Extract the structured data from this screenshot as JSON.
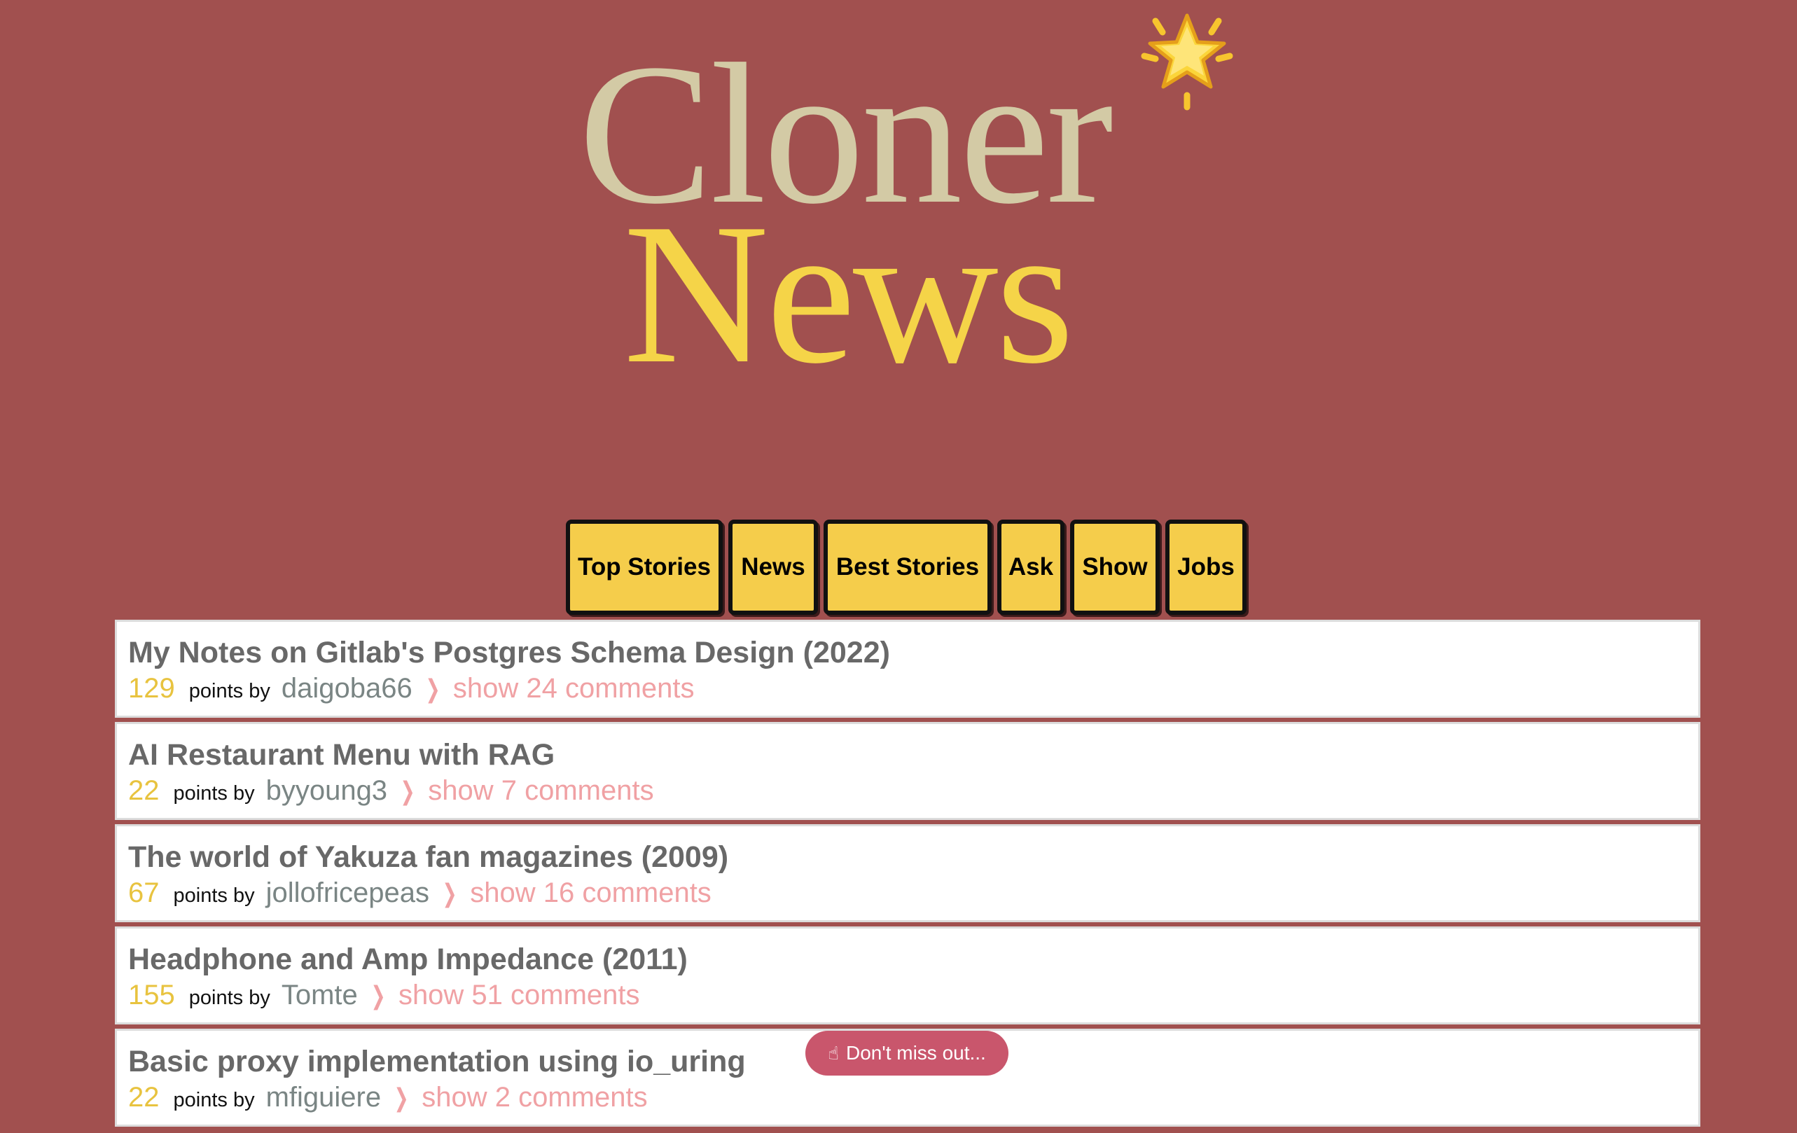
{
  "logo": {
    "line1": "Cloner",
    "line2": "News",
    "icon": "glowing-star-icon",
    "colors": {
      "cloner": "#d3caa5",
      "news": "#f5d448",
      "star": "#f7c52e"
    }
  },
  "nav": {
    "tabs": [
      {
        "label": "Top Stories"
      },
      {
        "label": "News"
      },
      {
        "label": "Best Stories"
      },
      {
        "label": "Ask"
      },
      {
        "label": "Show"
      },
      {
        "label": "Jobs"
      }
    ]
  },
  "stories": [
    {
      "title": "My Notes on Gitlab's Postgres Schema Design (2022)",
      "points": "129",
      "by_label": "points by",
      "user": "daigoba66",
      "comments": "show 24 comments"
    },
    {
      "title": "AI Restaurant Menu with RAG",
      "points": "22",
      "by_label": "points by",
      "user": "byyoung3",
      "comments": "show 7 comments"
    },
    {
      "title": "The world of Yakuza fan magazines (2009)",
      "points": "67",
      "by_label": "points by",
      "user": "jollofricepeas",
      "comments": "show 16 comments"
    },
    {
      "title": "Headphone and Amp Impedance (2011)",
      "points": "155",
      "by_label": "points by",
      "user": "Tomte",
      "comments": "show 51 comments"
    },
    {
      "title": "Basic proxy implementation using io_uring",
      "points": "22",
      "by_label": "points by",
      "user": "mfiguiere",
      "comments": "show 2 comments"
    }
  ],
  "toast": {
    "icon": "pointing-up-hand-icon",
    "text": "Don't miss out..."
  },
  "colors": {
    "background": "#a1504f",
    "tab_fill": "#f5cd4b",
    "points": "#e8c33f",
    "comments": "#f0a1a4",
    "toast": "#c9566c"
  }
}
